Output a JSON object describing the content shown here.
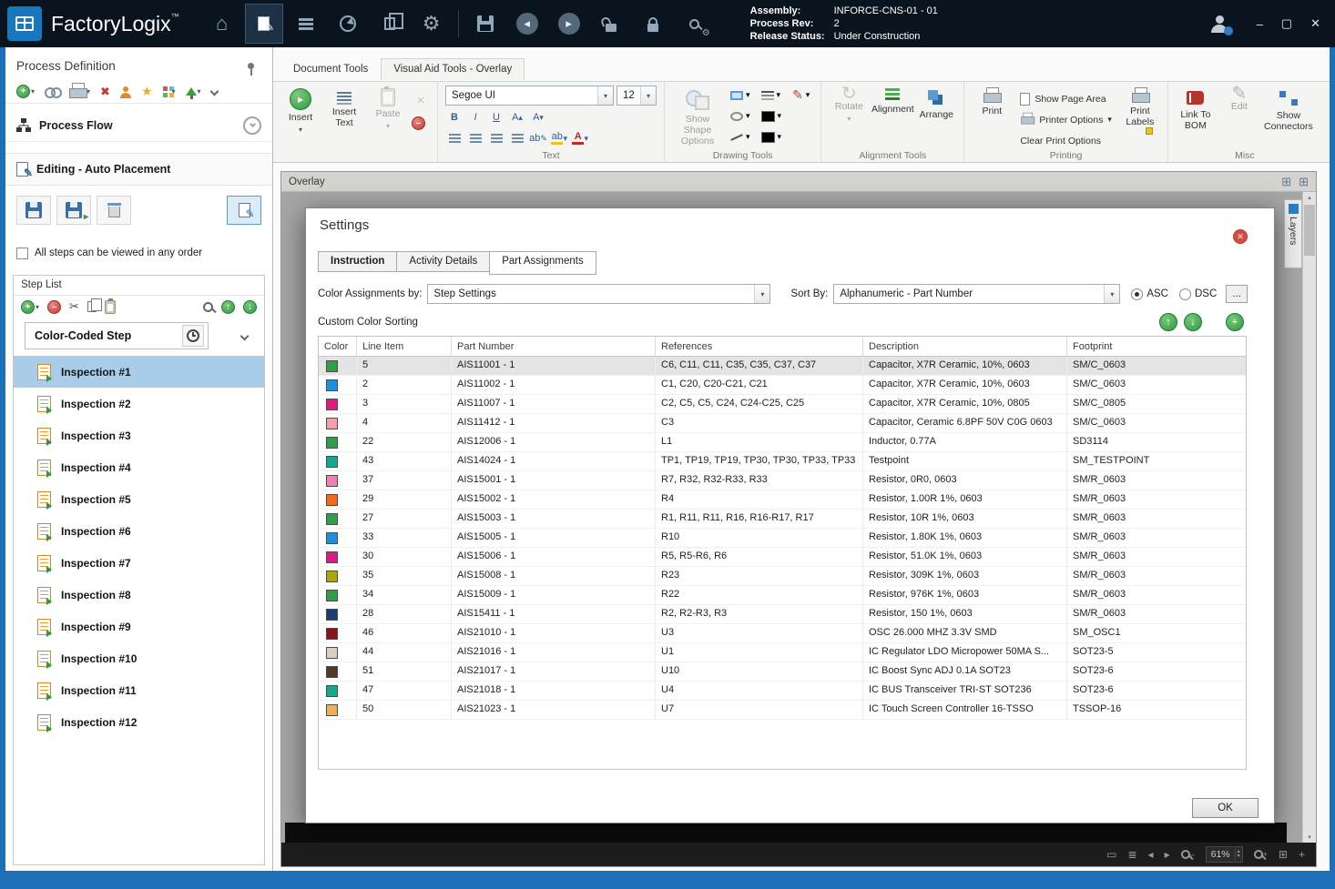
{
  "icons": {
    "home": "⌂",
    "gear": "⚙",
    "pencil": "✎",
    "scissors": "✂",
    "star": "★",
    "red_x": "✖",
    "caret_down": "▾",
    "caret_up": "▴",
    "nav_back": "◂",
    "nav_forward": "▸",
    "minimize": "–",
    "maximize": "▢",
    "close": "✕",
    "plus": "+",
    "minus": "–",
    "arrow_up": "↑",
    "arrow_down": "↓",
    "rotate": "↻",
    "bold": "B",
    "italic": "I",
    "underline": "U",
    "font_a": "A",
    "highlight_ab": "ab",
    "grid": "⊞",
    "board": "▭",
    "layers_glyph": "≣",
    "x_plain": "✕"
  },
  "titlebar": {
    "app_name": "FactoryLogix",
    "trademark": "™",
    "assembly_label": "Assembly:",
    "assembly_value": "INFORCE-CNS-01 - 01",
    "process_rev_label": "Process Rev:",
    "process_rev_value": "2",
    "release_status_label": "Release Status:",
    "release_status_value": "Under Construction"
  },
  "sidebar": {
    "title": "Process Definition",
    "process_flow_label": "Process Flow",
    "editing_label": "Editing - Auto Placement",
    "order_checkbox_label": "All steps can be viewed in any order",
    "step_list": {
      "title": "Step List",
      "color_coded_label": "Color-Coded Step",
      "steps": [
        {
          "label": "Inspection #1",
          "selected": true
        },
        {
          "label": "Inspection #2",
          "selected": false
        },
        {
          "label": "Inspection #3",
          "selected": false
        },
        {
          "label": "Inspection #4",
          "selected": false
        },
        {
          "label": "Inspection #5",
          "selected": false
        },
        {
          "label": "Inspection #6",
          "selected": false
        },
        {
          "label": "Inspection #7",
          "selected": false
        },
        {
          "label": "Inspection #8",
          "selected": false
        },
        {
          "label": "Inspection #9",
          "selected": false
        },
        {
          "label": "Inspection #10",
          "selected": false
        },
        {
          "label": "Inspection #11",
          "selected": false
        },
        {
          "label": "Inspection #12",
          "selected": false
        }
      ]
    }
  },
  "ribbon": {
    "tab_document": "Document Tools",
    "tab_visual": "Visual Aid Tools - Overlay",
    "insert": "Insert",
    "insert_text": "Insert Text",
    "paste": "Paste",
    "font_name": "Segoe UI",
    "font_size": "12",
    "text_caption": "Text",
    "show_shape_options": "Show Shape Options",
    "drawing_caption": "Drawing Tools",
    "rotate": "Rotate",
    "alignment": "Alignment",
    "arrange": "Arrange",
    "alignment_caption": "Alignment Tools",
    "print": "Print",
    "show_page_area": "Show Page Area",
    "printer_options": "Printer Options",
    "clear_print_options": "Clear Print Options",
    "print_labels": "Print Labels",
    "printing_caption": "Printing",
    "link_to_bom": "Link To BOM",
    "edit": "Edit",
    "show_connectors": "Show Connectors",
    "misc_caption": "Misc"
  },
  "overlay": {
    "title": "Overlay",
    "layers_tab": "Layers"
  },
  "dialog": {
    "title": "Settings",
    "tabs": {
      "instruction": "Instruction",
      "activity_details": "Activity Details",
      "part_assignments": "Part Assignments"
    },
    "color_assignments_label": "Color Assignments by:",
    "color_assignments_value": "Step Settings",
    "sort_by_label": "Sort By:",
    "sort_by_value": "Alphanumeric - Part Number",
    "asc_label": "ASC",
    "dsc_label": "DSC",
    "more_button": "...",
    "custom_color_sorting_label": "Custom Color Sorting",
    "table": {
      "columns": [
        "Color",
        "Line Item",
        "Part Number",
        "References",
        "Description",
        "Footprint"
      ],
      "rows": [
        {
          "color": "#2f9e49",
          "line_item": "5",
          "part_number": "AIS11001 - 1",
          "references": "C6, C11, C11, C35, C35, C37, C37",
          "description": "Capacitor, X7R Ceramic, 10%, 0603",
          "footprint": "SM/C_0603",
          "selected": true
        },
        {
          "color": "#1f8fd6",
          "line_item": "2",
          "part_number": "AIS11002 - 1",
          "references": "C1, C20, C20-C21, C21",
          "description": "Capacitor, X7R Ceramic, 10%, 0603",
          "footprint": "SM/C_0603",
          "selected": false
        },
        {
          "color": "#e01987",
          "line_item": "3",
          "part_number": "AIS11007 - 1",
          "references": "C2, C5, C5, C24, C24-C25, C25",
          "description": "Capacitor, X7R Ceramic, 10%, 0805",
          "footprint": "SM/C_0805",
          "selected": false
        },
        {
          "color": "#f2a0ab",
          "line_item": "4",
          "part_number": "AIS11412 - 1",
          "references": "C3",
          "description": "Capacitor, Ceramic 6.8PF 50V C0G 0603",
          "footprint": "SM/C_0603",
          "selected": false
        },
        {
          "color": "#2f9e49",
          "line_item": "22",
          "part_number": "AIS12006 - 1",
          "references": "L1",
          "description": "Inductor, 0.77A",
          "footprint": "SD3114",
          "selected": false
        },
        {
          "color": "#16a78c",
          "line_item": "43",
          "part_number": "AIS14024 - 1",
          "references": "TP1, TP19, TP19, TP30, TP30, TP33, TP33",
          "description": "Testpoint",
          "footprint": "SM_TESTPOINT",
          "selected": false
        },
        {
          "color": "#ee7fae",
          "line_item": "37",
          "part_number": "AIS15001 - 1",
          "references": "R7, R32, R32-R33, R33",
          "description": "Resistor, 0R0, 0603",
          "footprint": "SM/R_0603",
          "selected": false
        },
        {
          "color": "#f06a1d",
          "line_item": "29",
          "part_number": "AIS15002 - 1",
          "references": "R4",
          "description": "Resistor, 1.00R 1%, 0603",
          "footprint": "SM/R_0603",
          "selected": false
        },
        {
          "color": "#2f9e49",
          "line_item": "27",
          "part_number": "AIS15003 - 1",
          "references": "R1, R11, R11, R16, R16-R17, R17",
          "description": "Resistor, 10R 1%, 0603",
          "footprint": "SM/R_0603",
          "selected": false
        },
        {
          "color": "#1f8fd6",
          "line_item": "33",
          "part_number": "AIS15005 - 1",
          "references": "R10",
          "description": "Resistor, 1.80K 1%, 0603",
          "footprint": "SM/R_0603",
          "selected": false
        },
        {
          "color": "#e01987",
          "line_item": "30",
          "part_number": "AIS15006 - 1",
          "references": "R5, R5-R6, R6",
          "description": "Resistor, 51.0K 1%, 0603",
          "footprint": "SM/R_0603",
          "selected": false
        },
        {
          "color": "#aaa613",
          "line_item": "35",
          "part_number": "AIS15008 - 1",
          "references": "R23",
          "description": "Resistor, 309K 1%, 0603",
          "footprint": "SM/R_0603",
          "selected": false
        },
        {
          "color": "#2f9e49",
          "line_item": "34",
          "part_number": "AIS15009 - 1",
          "references": "R22",
          "description": "Resistor, 976K 1%, 0603",
          "footprint": "SM/R_0603",
          "selected": false
        },
        {
          "color": "#1b3e6f",
          "line_item": "28",
          "part_number": "AIS15411 - 1",
          "references": "R2, R2-R3, R3",
          "description": "Resistor, 150 1%, 0603",
          "footprint": "SM/R_0603",
          "selected": false
        },
        {
          "color": "#8e1117",
          "line_item": "46",
          "part_number": "AIS21010 - 1",
          "references": "U3",
          "description": "OSC 26.000 MHZ 3.3V SMD",
          "footprint": "SM_OSC1",
          "selected": false
        },
        {
          "color": "#d7d0c5",
          "line_item": "44",
          "part_number": "AIS21016 - 1",
          "references": "U1",
          "description": "IC Regulator LDO Micropower 50MA S...",
          "footprint": "SOT23-5",
          "selected": false
        },
        {
          "color": "#533826",
          "line_item": "51",
          "part_number": "AIS21017 - 1",
          "references": "U10",
          "description": "IC Boost Sync ADJ 0.1A SOT23",
          "footprint": "SOT23-6",
          "selected": false
        },
        {
          "color": "#16a78c",
          "line_item": "47",
          "part_number": "AIS21018 - 1",
          "references": "U4",
          "description": "IC BUS Transceiver TRI-ST SOT236",
          "footprint": "SOT23-6",
          "selected": false
        },
        {
          "color": "#f4ae56",
          "line_item": "50",
          "part_number": "AIS21023 - 1",
          "references": "U7",
          "description": "IC Touch Screen Controller 16-TSSO",
          "footprint": "TSSOP-16",
          "selected": false
        }
      ]
    },
    "ok_button": "OK"
  },
  "statusbar": {
    "zoom": "61%"
  }
}
